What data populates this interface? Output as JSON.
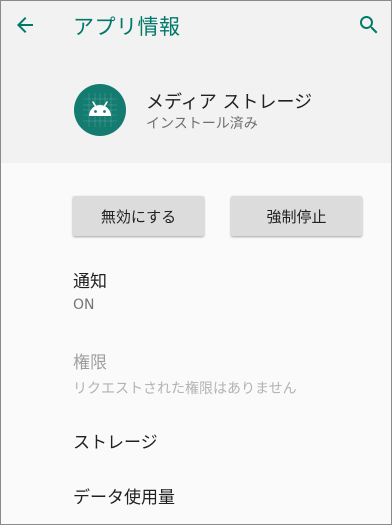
{
  "toolbar": {
    "title": "アプリ情報",
    "back_icon": "arrow-back-icon",
    "search_icon": "search-icon",
    "accent_color": "#00796b"
  },
  "app": {
    "name": "メディア ストレージ",
    "status": "インストール済み",
    "icon": "android-icon",
    "icon_bg_color": "#137b70"
  },
  "actions": {
    "disable_label": "無効にする",
    "force_stop_label": "強制停止"
  },
  "settings": {
    "notifications": {
      "title": "通知",
      "summary": "ON"
    },
    "permissions": {
      "title": "権限",
      "summary": "リクエストされた権限はありません"
    },
    "storage": {
      "title": "ストレージ"
    },
    "data_usage": {
      "title": "データ使用量"
    }
  }
}
